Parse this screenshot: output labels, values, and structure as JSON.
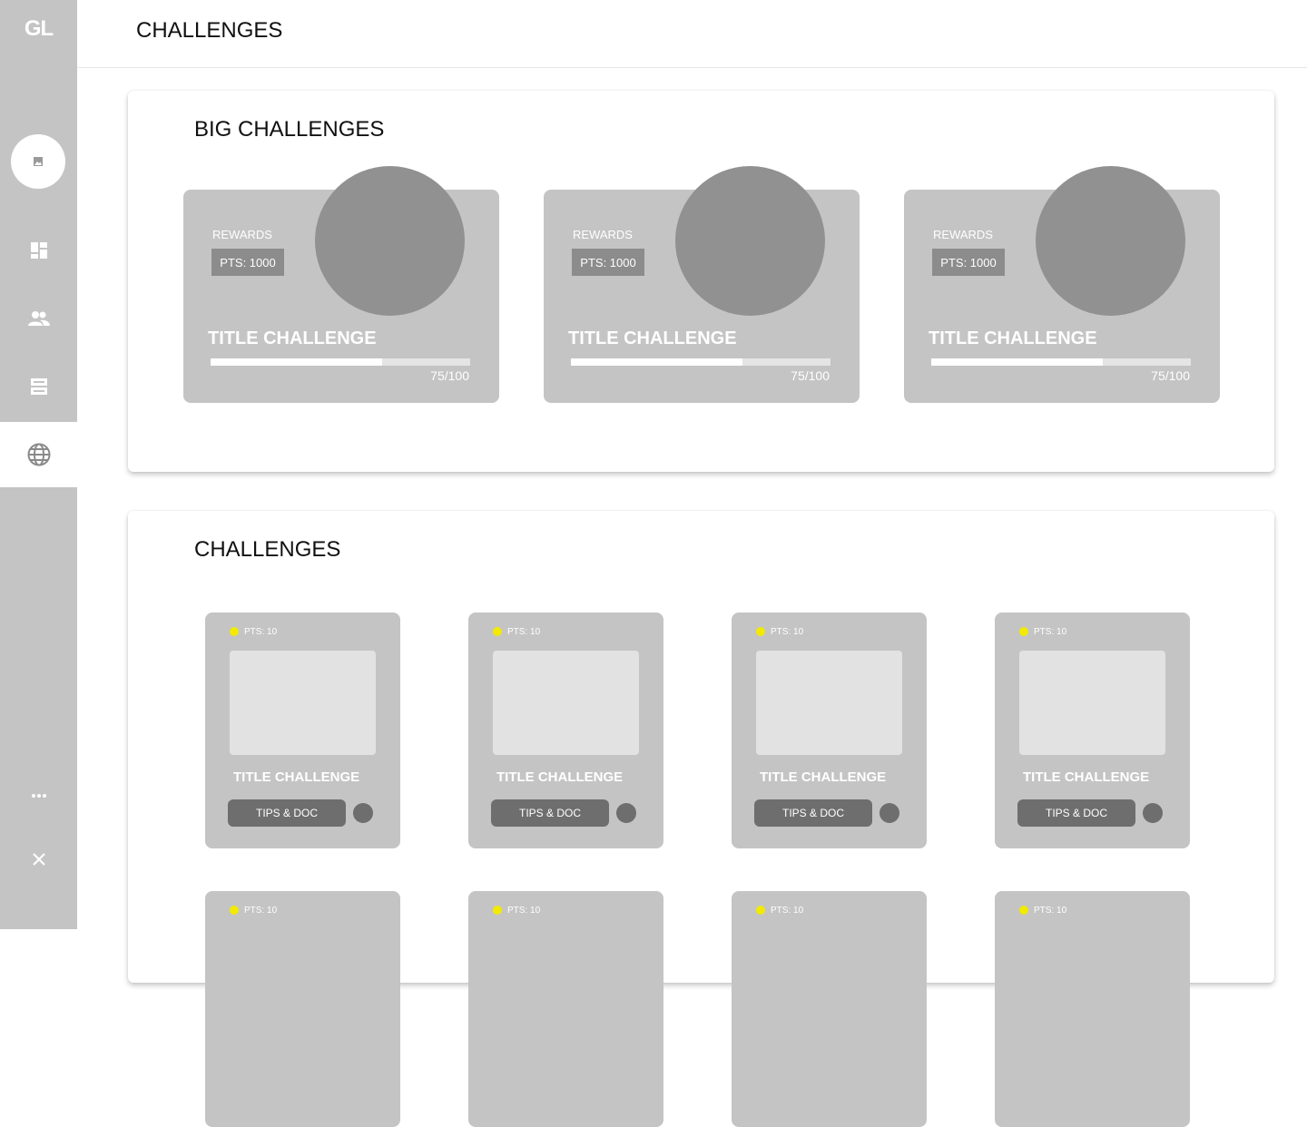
{
  "sidebar": {
    "logo": "GL",
    "icons": [
      "image-icon",
      "dashboard-icon",
      "people-icon",
      "storage-icon",
      "globe-icon",
      "more-icon",
      "close-icon"
    ],
    "active_item": "globe"
  },
  "header": {
    "title": "CHALLENGES"
  },
  "big_challenges": {
    "title": "BIG CHALLENGES",
    "cards": [
      {
        "rewards_label": "REWARDS",
        "points": "PTS: 1000",
        "title": "TITLE CHALLENGE",
        "progress_text": "75/100",
        "progress": 0.66
      },
      {
        "rewards_label": "REWARDS",
        "points": "PTS: 1000",
        "title": "TITLE CHALLENGE",
        "progress_text": "75/100",
        "progress": 0.66
      },
      {
        "rewards_label": "REWARDS",
        "points": "PTS: 1000",
        "title": "TITLE CHALLENGE",
        "progress_text": "75/100",
        "progress": 0.66
      }
    ]
  },
  "challenges": {
    "title": "CHALLENGES",
    "cards": [
      {
        "points": "PTS: 10",
        "title": "TITLE CHALLENGE",
        "button": "TIPS & DOC"
      },
      {
        "points": "PTS: 10",
        "title": "TITLE CHALLENGE",
        "button": "TIPS & DOC"
      },
      {
        "points": "PTS: 10",
        "title": "TITLE CHALLENGE",
        "button": "TIPS & DOC"
      },
      {
        "points": "PTS: 10",
        "title": "TITLE CHALLENGE",
        "button": "TIPS & DOC"
      },
      {
        "points": "PTS: 10"
      },
      {
        "points": "PTS: 10"
      },
      {
        "points": "PTS: 10"
      },
      {
        "points": "PTS: 10"
      }
    ]
  },
  "colors": {
    "sidebar": "#c4c4c4",
    "card": "#c4c4c4",
    "circle": "#919191",
    "button": "#6e6e6e",
    "points_dot": "#f2ea00"
  }
}
